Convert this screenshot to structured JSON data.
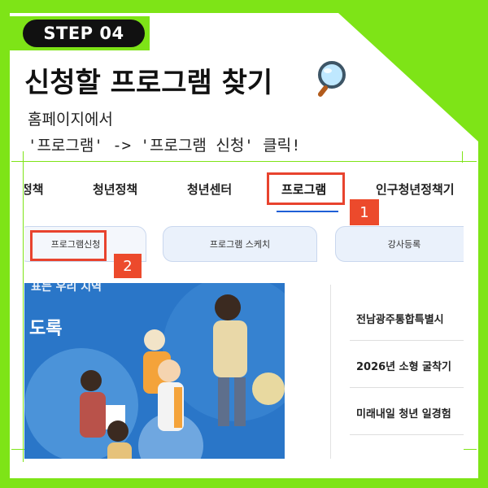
{
  "step": {
    "label": "STEP 04"
  },
  "title": "신청할 프로그램 찾기",
  "title_icon": "magnifier-icon",
  "description": {
    "line1": "홈페이지에서",
    "line2": "'프로그램' -> '프로그램 신청' 클릭!"
  },
  "nav": {
    "items": [
      {
        "label": "정책"
      },
      {
        "label": "청년정책"
      },
      {
        "label": "청년센터"
      },
      {
        "label": "프로그램"
      },
      {
        "label": "인구청년정책기"
      }
    ]
  },
  "subtabs": [
    {
      "label": "프로그램신청"
    },
    {
      "label": "프로그램 스케치"
    },
    {
      "label": "강사등록"
    }
  ],
  "markers": {
    "first": "1",
    "second": "2"
  },
  "banner": {
    "line_top": "표는 우리 지역",
    "line_main": "도록"
  },
  "list_items": [
    {
      "label": "전남광주통합특별시"
    },
    {
      "label": "2026년 소형 굴착기"
    },
    {
      "label": "미래내일 청년 일경험"
    }
  ],
  "colors": {
    "background": "#7ee417",
    "highlight_box": "#e8432e",
    "badge": "#ec4a2c",
    "active_underline": "#1e5fd6"
  }
}
